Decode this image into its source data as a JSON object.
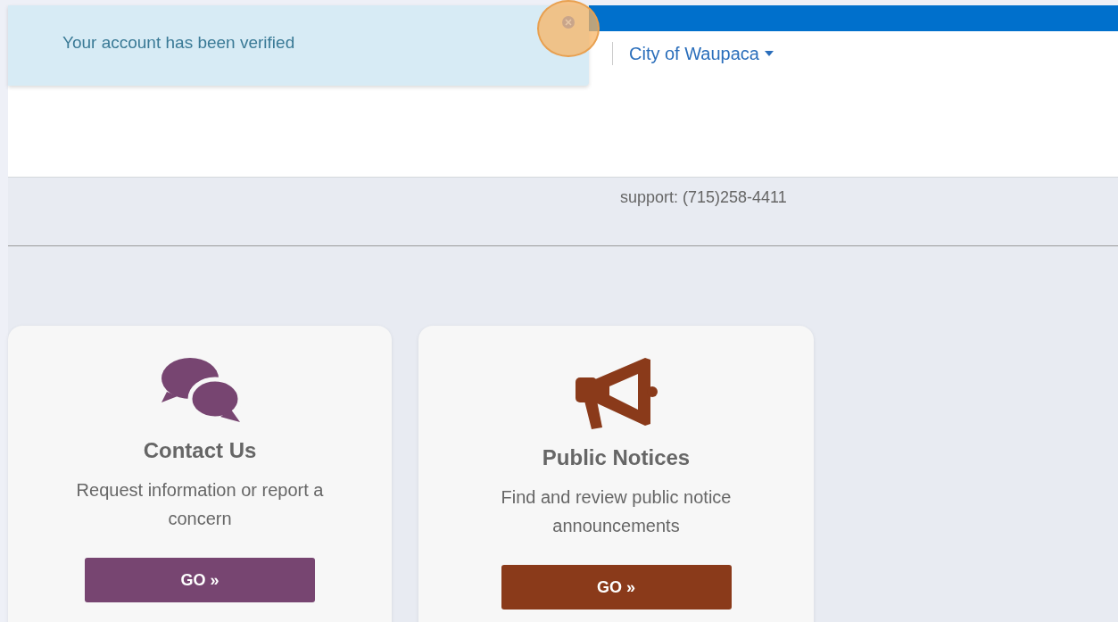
{
  "toast": {
    "message": "Your account has been verified"
  },
  "header": {
    "location": "City of Waupaca"
  },
  "support": {
    "text": "support: (715)258-4411"
  },
  "cards": [
    {
      "kind": "chat",
      "title": "Contact Us",
      "description": "Request information or report a concern",
      "button": "GO »",
      "color": "#774571"
    },
    {
      "kind": "announcement",
      "title": "Public Notices",
      "description": "Find and review public notice announcements",
      "button": "GO »",
      "color": "#8a3a1a"
    }
  ]
}
